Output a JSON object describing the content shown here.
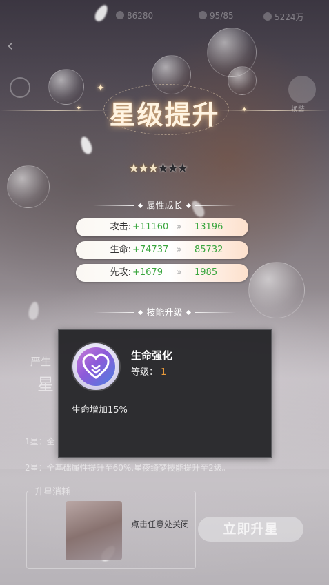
{
  "topbar": {
    "resources": [
      {
        "icon": "gem-icon",
        "value": "86280"
      },
      {
        "icon": "stamina-icon",
        "value": "95/85"
      },
      {
        "icon": "coin-icon",
        "value": "5224万"
      }
    ]
  },
  "header": {
    "title": "星级提升",
    "skin_label": "换装"
  },
  "stars": {
    "filled": 3,
    "total": 6
  },
  "attributes": {
    "heading": "属性成长",
    "rows": [
      {
        "name": "攻击:",
        "gain": "+11160",
        "value": "13196"
      },
      {
        "name": "生命:",
        "gain": "+74737",
        "value": "85732"
      },
      {
        "name": "先攻:",
        "gain": "+1679",
        "value": "1985"
      }
    ]
  },
  "skill_section": {
    "heading": "技能升级"
  },
  "skill_popup": {
    "name": "生命强化",
    "level_label": "等级：",
    "level_value": "1",
    "description": "生命增加15%"
  },
  "background_panel": {
    "label_1": "严生",
    "label_2": "星",
    "line_1": "1星：全",
    "line_2": "2星：全基础属性提升至60%,星夜绮梦技能提升至2级。",
    "cost_title": "升星消耗"
  },
  "footer": {
    "close_hint": "点击任意处关闭",
    "upgrade_button": "立即升星"
  },
  "colors": {
    "gain_green": "#3aa63f",
    "level_orange": "#e99a3a",
    "popup_bg": "#26262a"
  }
}
